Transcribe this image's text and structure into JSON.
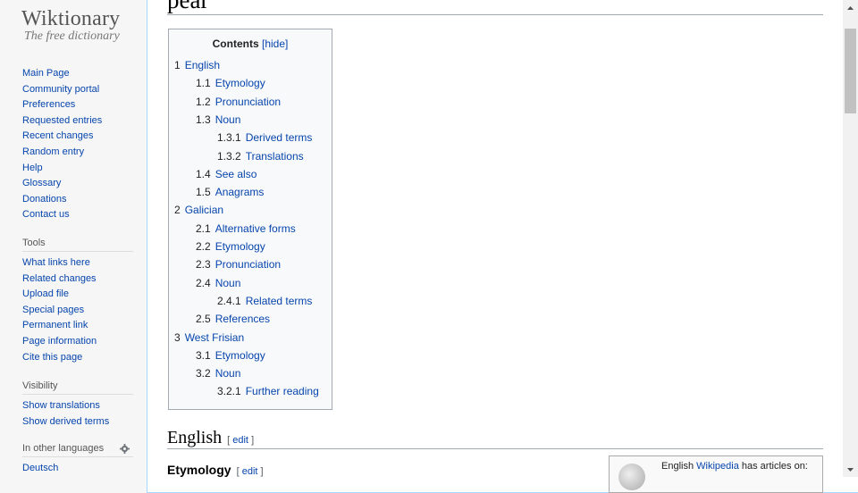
{
  "logo": {
    "name": "Wiktionary",
    "tagline": "The free dictionary"
  },
  "nav": {
    "items": [
      "Main Page",
      "Community portal",
      "Preferences",
      "Requested entries",
      "Recent changes",
      "Random entry",
      "Help",
      "Glossary",
      "Donations",
      "Contact us"
    ]
  },
  "tools": {
    "heading": "Tools",
    "items": [
      "What links here",
      "Related changes",
      "Upload file",
      "Special pages",
      "Permanent link",
      "Page information",
      "Cite this page"
    ]
  },
  "visibility": {
    "heading": "Visibility",
    "items": [
      "Show translations",
      "Show derived terms"
    ]
  },
  "languages": {
    "heading": "In other languages",
    "icon": "gear-icon",
    "items": [
      "Deutsch"
    ]
  },
  "page": {
    "title": "pear",
    "toc": {
      "title": "Contents",
      "hide": "[hide]",
      "items": [
        {
          "num": "1",
          "label": "English"
        },
        {
          "num": "1.1",
          "label": "Etymology"
        },
        {
          "num": "1.2",
          "label": "Pronunciation"
        },
        {
          "num": "1.3",
          "label": "Noun"
        },
        {
          "num": "1.3.1",
          "label": "Derived terms"
        },
        {
          "num": "1.3.2",
          "label": "Translations"
        },
        {
          "num": "1.4",
          "label": "See also"
        },
        {
          "num": "1.5",
          "label": "Anagrams"
        },
        {
          "num": "2",
          "label": "Galician"
        },
        {
          "num": "2.1",
          "label": "Alternative forms"
        },
        {
          "num": "2.2",
          "label": "Etymology"
        },
        {
          "num": "2.3",
          "label": "Pronunciation"
        },
        {
          "num": "2.4",
          "label": "Noun"
        },
        {
          "num": "2.4.1",
          "label": "Related terms"
        },
        {
          "num": "2.5",
          "label": "References"
        },
        {
          "num": "3",
          "label": "West Frisian"
        },
        {
          "num": "3.1",
          "label": "Etymology"
        },
        {
          "num": "3.2",
          "label": "Noun"
        },
        {
          "num": "3.2.1",
          "label": "Further reading"
        }
      ]
    },
    "section_heading": "English",
    "subsection_heading": "Etymology",
    "edit": "edit",
    "edit_open": "[",
    "edit_close": "]",
    "wikipedia_box": {
      "prefix": "English ",
      "link": "Wikipedia",
      "suffix": " has articles on:"
    }
  },
  "colors": {
    "link": "#0645ad",
    "border": "#a7d7f9",
    "toc_bg": "#f8f9fa"
  }
}
